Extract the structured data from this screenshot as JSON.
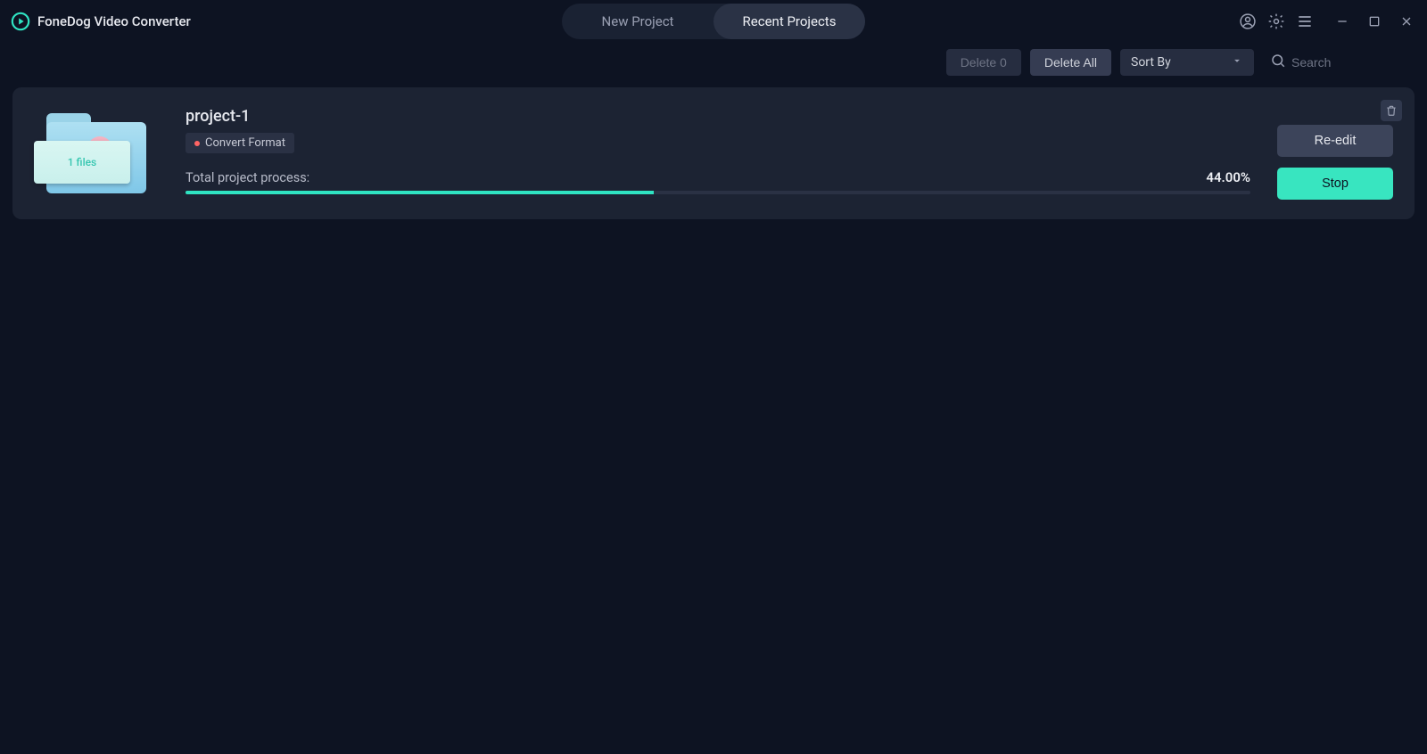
{
  "app": {
    "title": "FoneDog Video Converter"
  },
  "tabs": {
    "new": "New Project",
    "recent": "Recent Projects"
  },
  "toolbar": {
    "delete_n": "Delete 0",
    "delete_all": "Delete All",
    "sort_by": "Sort By",
    "search_placeholder": "Search"
  },
  "project": {
    "name": "project-1",
    "files_label": "1 files",
    "chip": "Convert Format",
    "process_label": "Total project process:",
    "percent_text": "44.00%",
    "percent": 44,
    "reedit": "Re-edit",
    "stop": "Stop"
  }
}
